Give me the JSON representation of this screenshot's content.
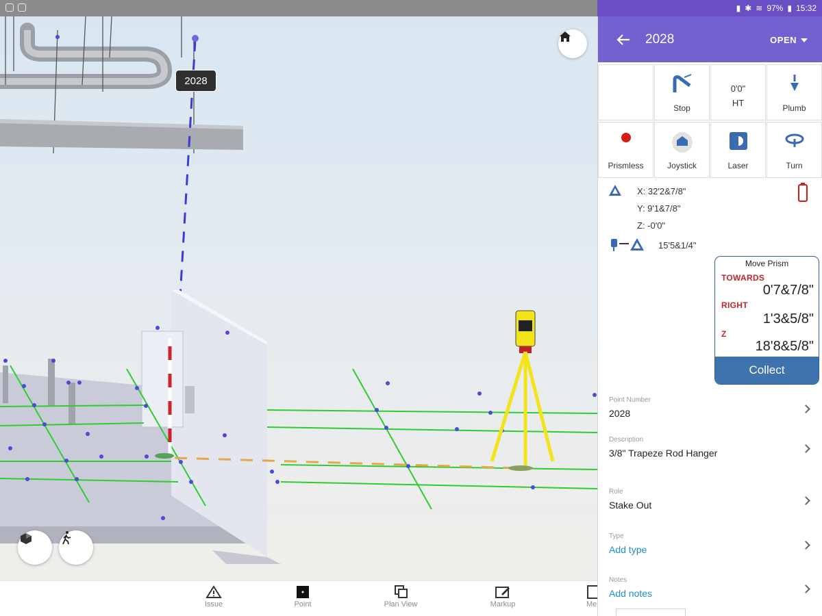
{
  "status": {
    "battery": "97%",
    "time": "15:32"
  },
  "viewport": {
    "tooltip": "2028",
    "colors": {
      "grid": "#2ecc2e",
      "point": "#4a4adc",
      "stake_line": "#3a3ad8",
      "ground_line": "#e8a64a",
      "tripod": "#f2e418"
    }
  },
  "bottom_nav": {
    "items": [
      {
        "label": "Issue",
        "icon": "warning-triangle-icon"
      },
      {
        "label": "Point",
        "icon": "point-square-icon"
      },
      {
        "label": "Plan View",
        "icon": "plan-view-icon"
      },
      {
        "label": "Markup",
        "icon": "markup-pencil-icon"
      },
      {
        "label": "Me",
        "icon": "more-icon"
      }
    ]
  },
  "panel": {
    "title": "2028",
    "open_label": "OPEN",
    "controls": {
      "stop": "Stop",
      "ht_value": "0'0\"",
      "ht": "HT",
      "plumb": "Plumb",
      "prismless": "Prismless",
      "joystick": "Joystick",
      "laser": "Laser",
      "turn": "Turn"
    },
    "position": {
      "x": "X: 32'2&7/8\"",
      "y": "Y: 9'1&7/8\"",
      "z": "Z: -0'0\"",
      "distance": "15'5&1/4\""
    },
    "move_prism": {
      "title": "Move Prism",
      "towards_label": "TOWARDS",
      "towards_value": "0'7&7/8\"",
      "right_label": "RIGHT",
      "right_value": "1'3&5/8\"",
      "z_label": "Z",
      "z_value": "18'8&5/8\"",
      "collect_label": "Collect"
    },
    "fields": {
      "point_number_label": "Point Number",
      "point_number_value": "2028",
      "description_label": "Description",
      "description_value": "3/8\" Trapeze Rod Hanger",
      "role_label": "Role",
      "role_value": "Stake Out",
      "type_label": "Type",
      "type_value": "Add type",
      "notes_label": "Notes",
      "notes_value": "Add notes"
    }
  }
}
